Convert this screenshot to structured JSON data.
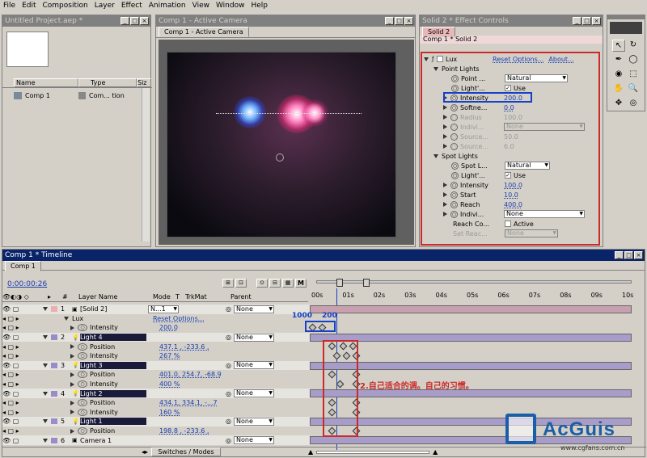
{
  "menu": [
    "File",
    "Edit",
    "Composition",
    "Layer",
    "Effect",
    "Animation",
    "View",
    "Window",
    "Help"
  ],
  "project": {
    "title": "Untitled Project.aep *",
    "col_name": "Name",
    "col_type": "Type",
    "col_size": "Siz",
    "item_name": "Comp 1",
    "item_type": "Com... tion"
  },
  "comp": {
    "title": "Comp 1 - Active Camera",
    "tab": "Comp 1 - Active Camera"
  },
  "effect_controls": {
    "title": "Solid 2 * Effect Controls",
    "tab": "Solid 2",
    "breadcrumb": "Comp 1 * Solid 2",
    "effect": "Lux",
    "reset": "Reset Options...",
    "about": "About...",
    "point_lights": "Point Lights",
    "point": "Point ...",
    "point_val": "Natural",
    "light1": "Light'...",
    "use": "Use",
    "intensity": "Intensity",
    "intensity_val": "200.0",
    "softne": "Softne...",
    "softne_val": "0.0",
    "radius": "Radius",
    "radius_val": "100.0",
    "indivi": "Indivi...",
    "none": "None",
    "source1": "Source...",
    "source1_val": "50.0",
    "source2": "Source...",
    "source2_val": "6.0",
    "spot_lights": "Spot Lights",
    "spot": "Spot L...",
    "spot_val": "Natural",
    "light2": "Light'...",
    "intensity2": "Intensity",
    "intensity2_val": "100.0",
    "start": "Start",
    "start_val": "10.0",
    "reach": "Reach",
    "reach_val": "400.0",
    "indivi2": "Indivi...",
    "reach_co": "Reach Co...",
    "active": "Active",
    "set_reac": "Set Reac..."
  },
  "timeline": {
    "title": "Comp 1 * Timeline",
    "tab": "Comp 1",
    "time": "0:00:00:26",
    "switches": "Switches / Modes",
    "hdr_layer": "Layer Name",
    "hdr_mode": "Mode",
    "hdr_t": "T",
    "hdr_trkmat": "TrkMat",
    "hdr_parent": "Parent",
    "ruler": [
      "00s",
      "01s",
      "02s",
      "03s",
      "04s",
      "05s",
      "06s",
      "07s",
      "08s",
      "09s",
      "10s"
    ],
    "annot_1000": "1000",
    "annot_200": "200",
    "annot_text": "2.自己适合的调。自己的习惯。",
    "rows": [
      {
        "kind": "layer",
        "num": "1",
        "name": "[Solid 2]",
        "mode": "N...1",
        "parent": "None"
      },
      {
        "kind": "effect",
        "name": "Lux",
        "value": "Reset Options..."
      },
      {
        "kind": "prop",
        "name": "Intensity",
        "value": "200.0"
      },
      {
        "kind": "layer",
        "num": "2",
        "name": "Light 4",
        "parent": "None"
      },
      {
        "kind": "prop",
        "name": "Position",
        "value": "437.1 , -233.6 ,"
      },
      {
        "kind": "prop",
        "name": "Intensity",
        "value": "267 %"
      },
      {
        "kind": "layer",
        "num": "3",
        "name": "Light 3",
        "parent": "None"
      },
      {
        "kind": "prop",
        "name": "Position",
        "value": "401.0, 254.7, -68.9"
      },
      {
        "kind": "prop",
        "name": "Intensity",
        "value": "400 %"
      },
      {
        "kind": "layer",
        "num": "4",
        "name": "Light 2",
        "parent": "None"
      },
      {
        "kind": "prop",
        "name": "Position",
        "value": "434.1, 334.1, -...7"
      },
      {
        "kind": "prop",
        "name": "Intensity",
        "value": "160 %"
      },
      {
        "kind": "layer",
        "num": "5",
        "name": "Light 1",
        "parent": "None"
      },
      {
        "kind": "prop",
        "name": "Position",
        "value": "198.8 , -233.6 ,"
      },
      {
        "kind": "layer",
        "num": "6",
        "name": "Camera 1",
        "parent": "None"
      }
    ]
  },
  "watermark": {
    "brand": "AcGuis",
    "url": "www.cgfans.com.cn"
  },
  "colors": {
    "title_active": "#0a246a",
    "annotation_red": "#cc2a2a",
    "highlight_blue": "#1540c8",
    "solid_bar": "#c8a0b0",
    "light_bar": "#a89cc8"
  }
}
